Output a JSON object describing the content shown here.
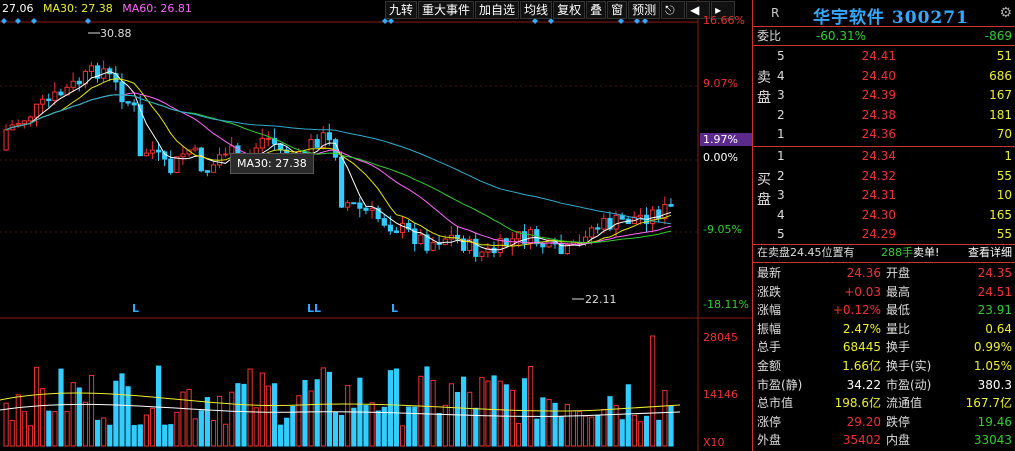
{
  "legend": {
    "ma5": "27.06",
    "ma30": "MA30: 27.38",
    "ma60": "MA60: 26.81",
    "colors": {
      "ma5": "#ffffff",
      "ma30": "#e6e600",
      "ma60": "#ff66ff"
    }
  },
  "toolbar": [
    "九转",
    "重大事件",
    "加自选",
    "均线",
    "复权",
    "叠",
    "窗",
    "预测"
  ],
  "price_axis": [
    "16.66%",
    "9.07%",
    "1.97%",
    "0.00%",
    "-9.05%",
    "-18.11%"
  ],
  "volume_axis": [
    "28045",
    "14146",
    "X10"
  ],
  "tooltip": "MA30: 27.38",
  "high_label": "30.88",
  "low_label": "22.11",
  "l_markers": [
    "L",
    "LL",
    "L"
  ],
  "header": {
    "r": "R",
    "title": "华宇软件 300271"
  },
  "weibi": {
    "label": "委比",
    "pct": "-60.31%",
    "diff": "-869"
  },
  "sell_side_label": [
    "卖",
    "盘"
  ],
  "buy_side_label": [
    "买",
    "盘"
  ],
  "asks": [
    {
      "lvl": "5",
      "price": "24.41",
      "vol": "51"
    },
    {
      "lvl": "4",
      "price": "24.40",
      "vol": "686"
    },
    {
      "lvl": "3",
      "price": "24.39",
      "vol": "167"
    },
    {
      "lvl": "2",
      "price": "24.38",
      "vol": "181"
    },
    {
      "lvl": "1",
      "price": "24.36",
      "vol": "70"
    }
  ],
  "bids": [
    {
      "lvl": "1",
      "price": "24.34",
      "vol": "1"
    },
    {
      "lvl": "2",
      "price": "24.32",
      "vol": "55"
    },
    {
      "lvl": "3",
      "price": "24.31",
      "vol": "10"
    },
    {
      "lvl": "4",
      "price": "24.30",
      "vol": "165"
    },
    {
      "lvl": "5",
      "price": "24.29",
      "vol": "55"
    }
  ],
  "info_bar": {
    "text": "在卖盘24.45位置有",
    "qty": "288手",
    "action": "卖单!",
    "detail": "查看详细"
  },
  "quote": [
    {
      "k1": "最新",
      "v1": "24.36",
      "c1": "red",
      "k2": "开盘",
      "v2": "24.35",
      "c2": "red"
    },
    {
      "k1": "涨跌",
      "v1": "+0.03",
      "c1": "red",
      "k2": "最高",
      "v2": "24.51",
      "c2": "red"
    },
    {
      "k1": "涨幅",
      "v1": "+0.12%",
      "c1": "red",
      "k2": "最低",
      "v2": "23.91",
      "c2": "green"
    },
    {
      "k1": "振幅",
      "v1": "2.47%",
      "c1": "yellow",
      "k2": "量比",
      "v2": "0.64",
      "c2": "yellow"
    },
    {
      "k1": "总手",
      "v1": "68445",
      "c1": "yellow",
      "k2": "换手",
      "v2": "0.99%",
      "c2": "yellow"
    },
    {
      "k1": "金额",
      "v1": "1.66亿",
      "c1": "yellow",
      "k2": "换手(实)",
      "v2": "1.05%",
      "c2": "yellow"
    },
    {
      "k1": "市盈(静)",
      "v1": "34.22",
      "c1": "white",
      "k2": "市盈(动)",
      "v2": "380.3",
      "c2": "white"
    },
    {
      "k1": "总市值",
      "v1": "198.6亿",
      "c1": "yellow",
      "k2": "流通值",
      "v2": "167.7亿",
      "c2": "yellow"
    },
    {
      "k1": "涨停",
      "v1": "29.20",
      "c1": "red",
      "k2": "跌停",
      "v2": "19.46",
      "c2": "green"
    },
    {
      "k1": "外盘",
      "v1": "35402",
      "c1": "red",
      "k2": "内盘",
      "v2": "33043",
      "c2": "green"
    }
  ]
}
